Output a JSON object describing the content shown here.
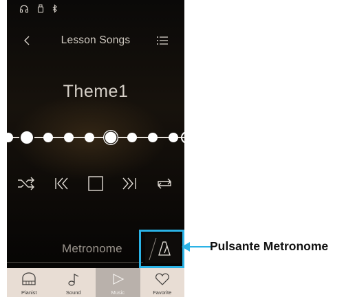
{
  "status_bar": {
    "icons": [
      "headphones-icon",
      "usb-memory-icon",
      "bluetooth-icon"
    ]
  },
  "header": {
    "back_icon": "chevron-left-icon",
    "title": "Lesson Songs",
    "menu_icon": "list-menu-icon"
  },
  "song": {
    "title": "Theme1"
  },
  "progress": {
    "dots_total": 10,
    "large_dot_index": [
      0,
      4
    ],
    "current_index": 4
  },
  "controls": {
    "icons": [
      "shuffle-icon",
      "previous-icon",
      "stop-icon",
      "next-icon",
      "repeat-icon"
    ]
  },
  "metronome": {
    "label": "Metronome",
    "button_icon": "metronome-icon"
  },
  "tabs": [
    {
      "label": "Pianist",
      "icon": "piano-icon",
      "active": false
    },
    {
      "label": "Sound",
      "icon": "note-icon",
      "active": false
    },
    {
      "label": "Music",
      "icon": "play-icon",
      "active": true
    },
    {
      "label": "Favorite",
      "icon": "heart-icon",
      "active": false
    }
  ],
  "callout": {
    "text": "Pulsante Metronome",
    "accent_color": "#2bb3e6"
  }
}
